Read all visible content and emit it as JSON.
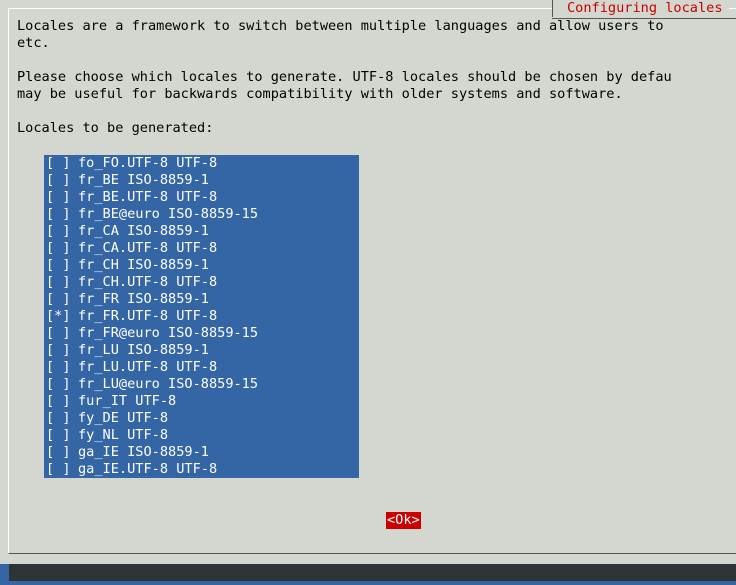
{
  "dialog": {
    "title": "Configuring locales",
    "description": [
      "Locales are a framework to switch between multiple languages and allow users to",
      "etc.",
      "",
      "Please choose which locales to generate. UTF-8 locales should be chosen by defau",
      "may be useful for backwards compatibility with older systems and software.",
      "",
      "Locales to be generated:"
    ]
  },
  "locales": [
    {
      "checkbox": "[ ]",
      "label": "fo_FO.UTF-8 UTF-8"
    },
    {
      "checkbox": "[ ]",
      "label": "fr_BE ISO-8859-1"
    },
    {
      "checkbox": "[ ]",
      "label": "fr_BE.UTF-8 UTF-8"
    },
    {
      "checkbox": "[ ]",
      "label": "fr_BE@euro ISO-8859-15"
    },
    {
      "checkbox": "[ ]",
      "label": "fr_CA ISO-8859-1"
    },
    {
      "checkbox": "[ ]",
      "label": "fr_CA.UTF-8 UTF-8"
    },
    {
      "checkbox": "[ ]",
      "label": "fr_CH ISO-8859-1"
    },
    {
      "checkbox": "[ ]",
      "label": "fr_CH.UTF-8 UTF-8"
    },
    {
      "checkbox": "[ ]",
      "label": "fr_FR ISO-8859-1"
    },
    {
      "checkbox": "[*]",
      "label": "fr_FR.UTF-8 UTF-8"
    },
    {
      "checkbox": "[ ]",
      "label": "fr_FR@euro ISO-8859-15"
    },
    {
      "checkbox": "[ ]",
      "label": "fr_LU ISO-8859-1"
    },
    {
      "checkbox": "[ ]",
      "label": "fr_LU.UTF-8 UTF-8"
    },
    {
      "checkbox": "[ ]",
      "label": "fr_LU@euro ISO-8859-15"
    },
    {
      "checkbox": "[ ]",
      "label": "fur_IT UTF-8"
    },
    {
      "checkbox": "[ ]",
      "label": "fy_DE UTF-8"
    },
    {
      "checkbox": "[ ]",
      "label": "fy_NL UTF-8"
    },
    {
      "checkbox": "[ ]",
      "label": "ga_IE ISO-8859-1"
    },
    {
      "checkbox": "[ ]",
      "label": "ga_IE.UTF-8 UTF-8"
    }
  ],
  "ok_button": {
    "label": "<Ok>"
  },
  "colors": {
    "background": "#3465a4",
    "dialog": "#d3d7cf",
    "title": "#cc0000",
    "list_background": "#3465a4",
    "list_text": "#ffffff",
    "button_focus": "#cc0000"
  }
}
